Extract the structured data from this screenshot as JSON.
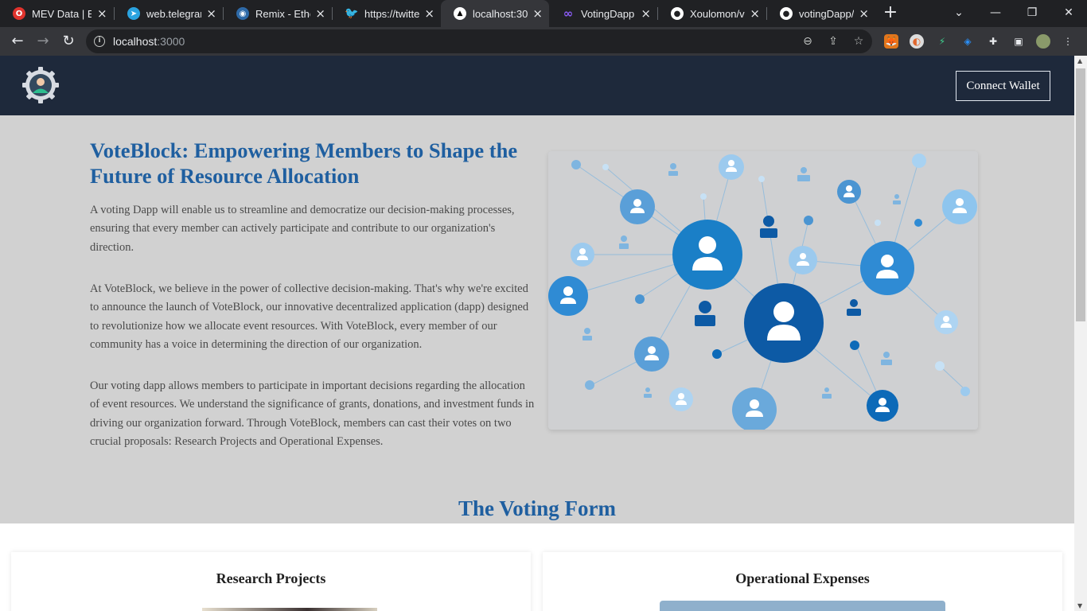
{
  "browser": {
    "tabs": [
      {
        "title": "MEV Data | Ei",
        "favicon": "opera-icon",
        "color": "#e0332d",
        "active": false
      },
      {
        "title": "web.telegram",
        "favicon": "telegram-icon",
        "color": "#2aa3e0",
        "active": false
      },
      {
        "title": "Remix - Ether",
        "favicon": "remix-icon",
        "color": "#3a8ed8",
        "active": false
      },
      {
        "title": "https://twitter",
        "favicon": "twitter-icon",
        "color": "#1d9bf0",
        "active": false
      },
      {
        "title": "localhost:300(",
        "favicon": "vercel-icon",
        "color": "#ffffff",
        "active": true
      },
      {
        "title": "VotingDapp |",
        "favicon": "infinity-icon",
        "color": "#8b5cf6",
        "active": false
      },
      {
        "title": "Xoulomon/vc",
        "favicon": "github-icon",
        "color": "#ffffff",
        "active": false
      },
      {
        "title": "votingDapp/V",
        "favicon": "github-icon",
        "color": "#ffffff",
        "active": false
      }
    ],
    "url_host": "localhost",
    "url_port": ":3000"
  },
  "site": {
    "connect_wallet": "Connect Wallet",
    "hero": {
      "title": "VoteBlock: Empowering Members to Shape the Future of Resource Allocation",
      "p1": "A voting Dapp will enable us to streamline and democratize our decision-making processes, ensuring that every member can actively participate and contribute to our organization's direction.",
      "p2": "At VoteBlock, we believe in the power of collective decision-making. That's why we're excited to announce the launch of VoteBlock, our innovative decentralized application (dapp) designed to revolutionize how we allocate event resources. With VoteBlock, every member of our community has a voice in determining the direction of our organization.",
      "p3": "Our voting dapp allows members to participate in important decisions regarding the allocation of event resources. We understand the significance of grants, donations, and investment funds in driving our organization forward. Through VoteBlock, members can cast their votes on two crucial proposals: Research Projects and Operational Expenses."
    },
    "voting_form_title": "The Voting Form",
    "cards": [
      {
        "title": "Research Projects"
      },
      {
        "title": "Operational Expenses"
      }
    ]
  }
}
